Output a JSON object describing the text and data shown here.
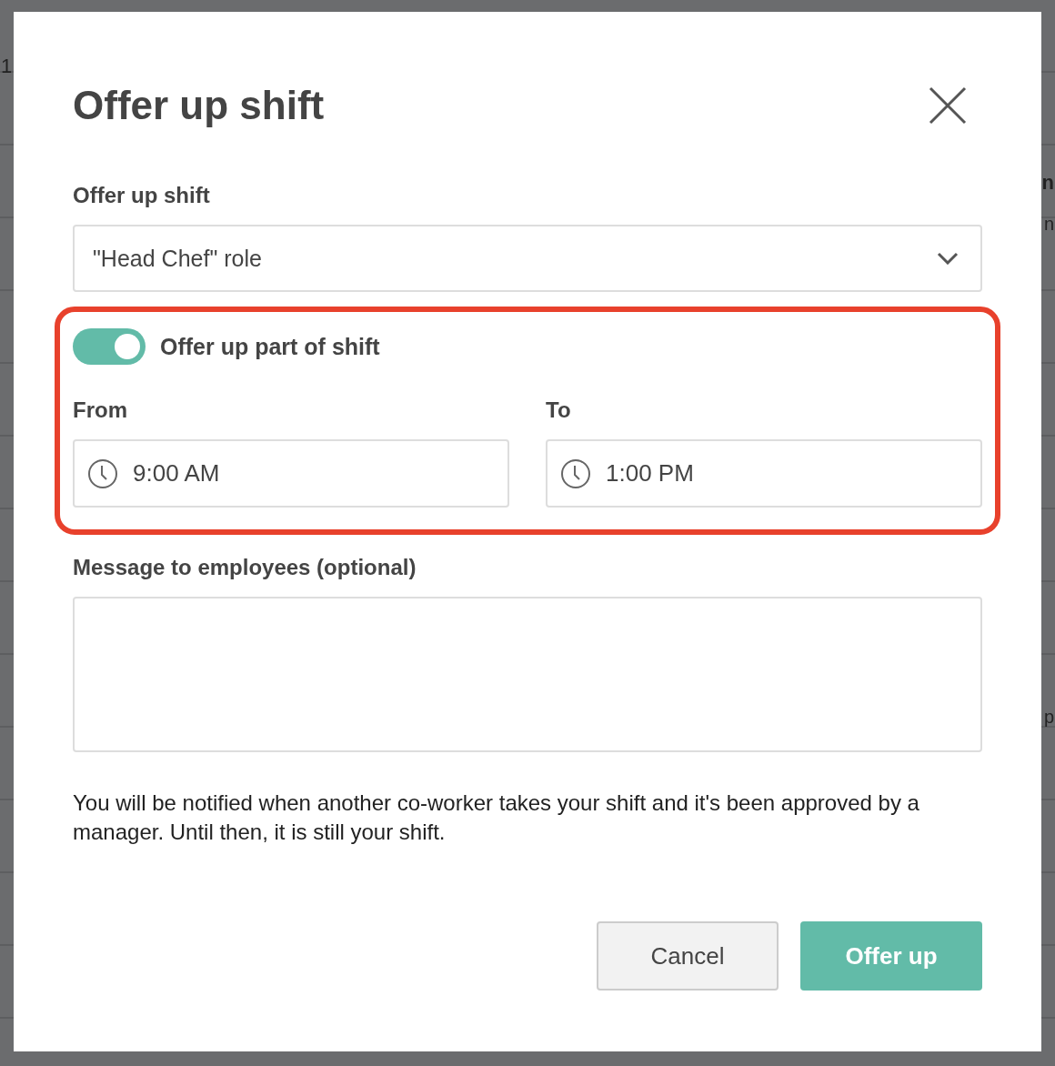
{
  "background": {
    "left_fragments": [
      "1"
    ],
    "right_fragments": [
      "n",
      "n",
      "p"
    ]
  },
  "dialog": {
    "title": "Offer up shift",
    "shift_field": {
      "label": "Offer up shift",
      "value": "\"Head Chef\" role"
    },
    "partial_toggle": {
      "label": "Offer up part of shift",
      "on": true
    },
    "time_fields": [
      {
        "label": "From",
        "value": "9:00 AM"
      },
      {
        "label": "To",
        "value": "1:00 PM"
      }
    ],
    "message_field": {
      "label": "Message to employees (optional)"
    },
    "note": "You will be notified when another co-worker takes your shift and it's been approved by a manager. Until then, it is still your shift.",
    "buttons": [
      {
        "label": "Cancel",
        "kind": "secondary"
      },
      {
        "label": "Offer up",
        "kind": "primary"
      }
    ]
  }
}
